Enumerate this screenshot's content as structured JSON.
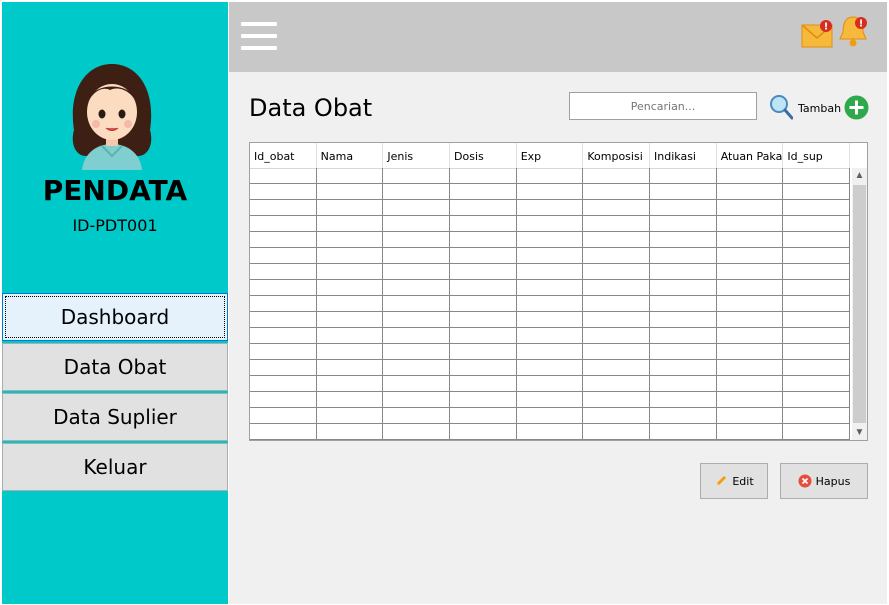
{
  "sidebar": {
    "role": "PENDATA",
    "user_id": "ID-PDT001",
    "nav": [
      {
        "label": "Dashboard"
      },
      {
        "label": "Data Obat"
      },
      {
        "label": "Data Suplier"
      },
      {
        "label": "Keluar"
      }
    ],
    "active_nav": "Dashboard"
  },
  "topbar": {
    "icons": [
      "menu-icon",
      "mail-icon",
      "bell-icon"
    ],
    "mail_badge": "!",
    "bell_badge": "!"
  },
  "main": {
    "title": "Data Obat",
    "search_placeholder": "Pencarian...",
    "add_label": "Tambah",
    "columns": [
      "Id_obat",
      "Nama",
      "Jenis",
      "Dosis",
      "Exp",
      "Komposisi",
      "Indikasi",
      "Atuan Pakai",
      "Id_sup"
    ],
    "rows": [],
    "edit_label": "Edit",
    "delete_label": "Hapus"
  },
  "colors": {
    "sidebar": "#00c9c9",
    "topbar": "#c8c8c8",
    "content": "#f0f0f0",
    "add_button": "#2ea84a",
    "delete_icon": "#e74c3c"
  }
}
